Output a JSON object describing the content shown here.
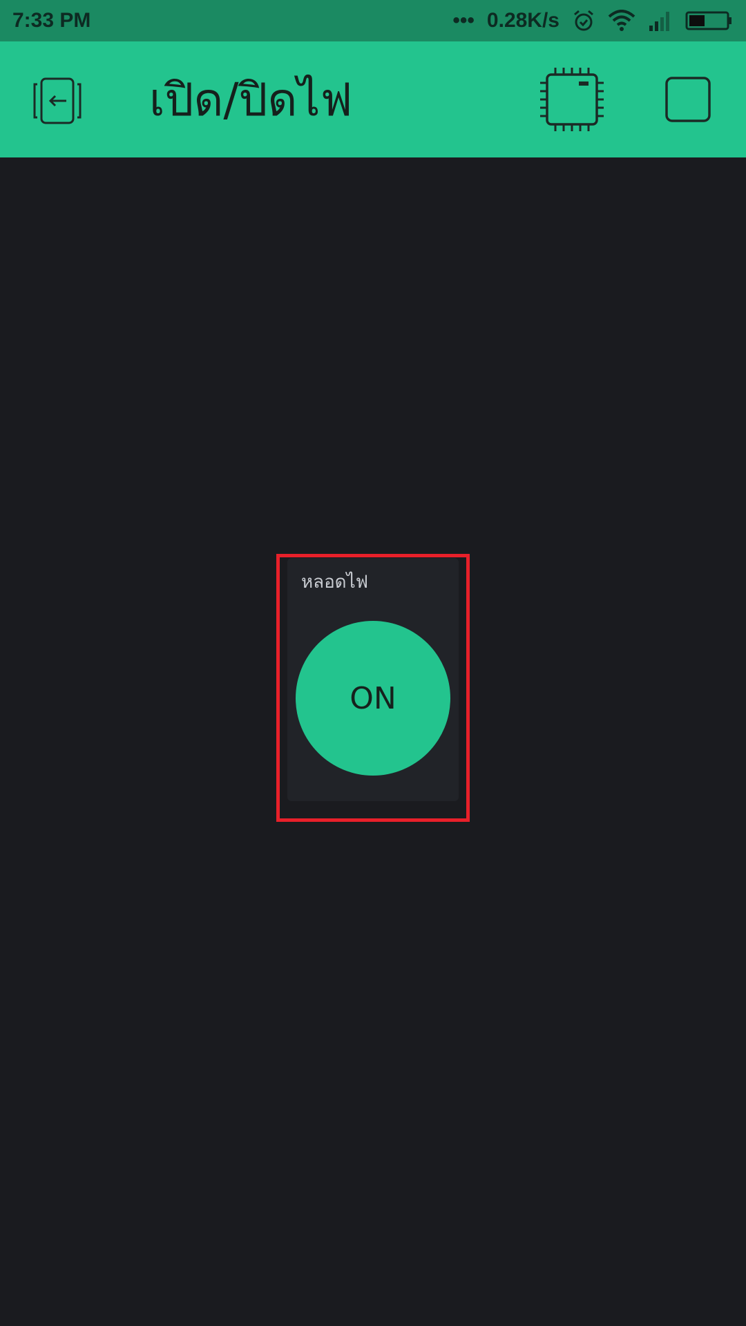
{
  "status_bar": {
    "time": "7:33 PM",
    "dots": "•••",
    "net_speed": "0.28K/s",
    "icons": [
      "alarm-icon",
      "wifi-icon",
      "signal-icon",
      "battery-icon"
    ]
  },
  "app_bar": {
    "title": "เปิด/ปิดไฟ",
    "icons": [
      "exit-icon",
      "device-chip-icon",
      "stop-square-icon"
    ]
  },
  "widget": {
    "label": "หลอดไฟ",
    "button_label": "ON"
  },
  "colors": {
    "accent": "#23c48e",
    "status_bar": "#1b8a62",
    "background": "#1a1b1f",
    "widget_bg": "#212328",
    "highlight": "#e8202a"
  }
}
